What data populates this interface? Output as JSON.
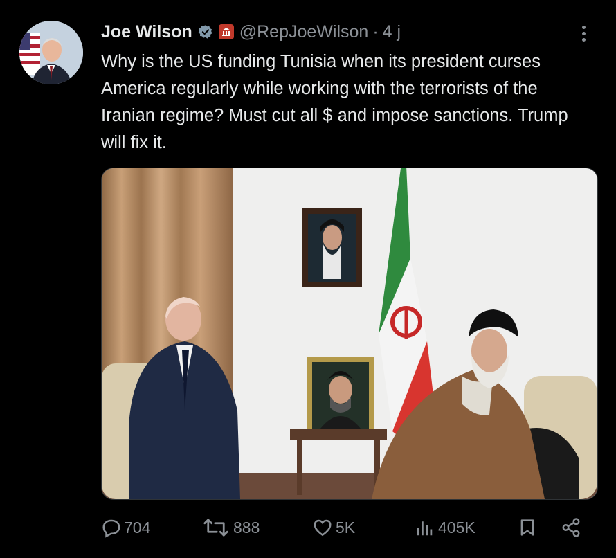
{
  "tweet": {
    "author_name": "Joe Wilson",
    "handle": "@RepJoeWilson",
    "separator": "·",
    "time": "4 j",
    "text": "Why is the US funding Tunisia when its president curses America regularly while working with the terrorists of the Iranian regime? Must cut all $ and impose sanctions. Trump will fix it."
  },
  "actions": {
    "replies": "704",
    "reposts": "888",
    "likes": "5K",
    "views": "405K"
  },
  "icons": {
    "verified": "verified-badge-icon",
    "government": "government-affiliation-icon",
    "more": "more-options-icon",
    "reply": "reply-icon",
    "repost": "repost-icon",
    "like": "heart-icon",
    "views": "views-chart-icon",
    "bookmark": "bookmark-icon",
    "share": "share-icon"
  },
  "colors": {
    "background": "#000000",
    "text_primary": "#e7e9ea",
    "text_secondary": "#8b9096",
    "verified_badge": "#829aab",
    "gov_badge": "#c0392b"
  }
}
